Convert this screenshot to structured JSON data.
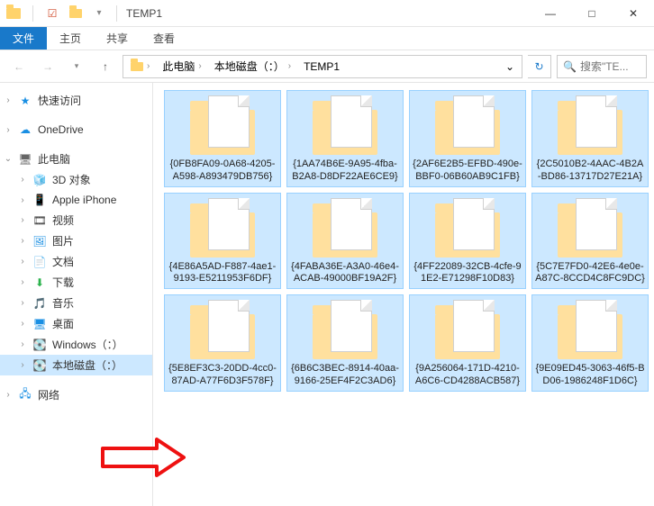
{
  "window": {
    "title": "TEMP1",
    "controls": {
      "min": "—",
      "max": "□",
      "close": "✕"
    }
  },
  "ribbon": {
    "file": "文件",
    "tabs": [
      "主页",
      "共享",
      "查看"
    ]
  },
  "addressbar": {
    "crumbs": [
      "此电脑",
      "本地磁盘（：）",
      "TEMP1"
    ],
    "dropdown_glyph": "⌄",
    "refresh_glyph": "↻"
  },
  "search": {
    "placeholder": "搜索\"TE...",
    "icon_glyph": "🔍"
  },
  "sidebar": {
    "quick_access": {
      "label": "快速访问",
      "icon": "★"
    },
    "onedrive": {
      "label": "OneDrive",
      "icon": "☁"
    },
    "this_pc": {
      "label": "此电脑",
      "icon": "🖥"
    },
    "children": [
      {
        "label": "3D 对象",
        "icon": "🧊",
        "icon_color": "#1a8fe3"
      },
      {
        "label": "Apple iPhone",
        "icon": "📱",
        "icon_color": "#333"
      },
      {
        "label": "视频",
        "icon": "🎞",
        "icon_color": "#333"
      },
      {
        "label": "图片",
        "icon": "🖼",
        "icon_color": "#1a8fe3"
      },
      {
        "label": "文档",
        "icon": "📄",
        "icon_color": "#1a8fe3"
      },
      {
        "label": "下载",
        "icon": "⬇",
        "icon_color": "#2bb24c"
      },
      {
        "label": "音乐",
        "icon": "🎵",
        "icon_color": "#1a8fe3"
      },
      {
        "label": "桌面",
        "icon": "🖥",
        "icon_color": "#1a8fe3"
      },
      {
        "label": "Windows（：）",
        "icon": "💽",
        "icon_color": "#666"
      },
      {
        "label": "本地磁盘（：）",
        "icon": "💽",
        "icon_color": "#666",
        "selected": true
      }
    ],
    "network": {
      "label": "网络",
      "icon": "🖧"
    }
  },
  "items": [
    {
      "name": "{0FB8FA09-0A68-4205-A598-A893479DB756}",
      "selected": true
    },
    {
      "name": "{1AA74B6E-9A95-4fba-B2A8-D8DF22AE6CE9}",
      "selected": true
    },
    {
      "name": "{2AF6E2B5-EFBD-490e-BBF0-06B60AB9C1FB}",
      "selected": true
    },
    {
      "name": "{2C5010B2-4AAC-4B2A-BD86-13717D27E21A}",
      "selected": true
    },
    {
      "name": "{4E86A5AD-F887-4ae1-9193-E5211953F6DF}",
      "selected": true
    },
    {
      "name": "{4FABA36E-A3A0-46e4-ACAB-49000BF19A2F}",
      "selected": true
    },
    {
      "name": "{4FF22089-32CB-4cfe-91E2-E71298F10D83}",
      "selected": true
    },
    {
      "name": "{5C7E7FD0-42E6-4e0e-A87C-8CCD4C8FC9DC}",
      "selected": true
    },
    {
      "name": "{5E8EF3C3-20DD-4cc0-87AD-A77F6D3F578F}",
      "selected": true
    },
    {
      "name": "{6B6C3BEC-8914-40aa-9166-25EF4F2C3AD6}",
      "selected": true
    },
    {
      "name": "{9A256064-171D-4210-A6C6-CD4288ACB587}",
      "selected": true
    },
    {
      "name": "{9E09ED45-3063-46f5-BD06-1986248F1D6C}",
      "selected": true
    }
  ]
}
